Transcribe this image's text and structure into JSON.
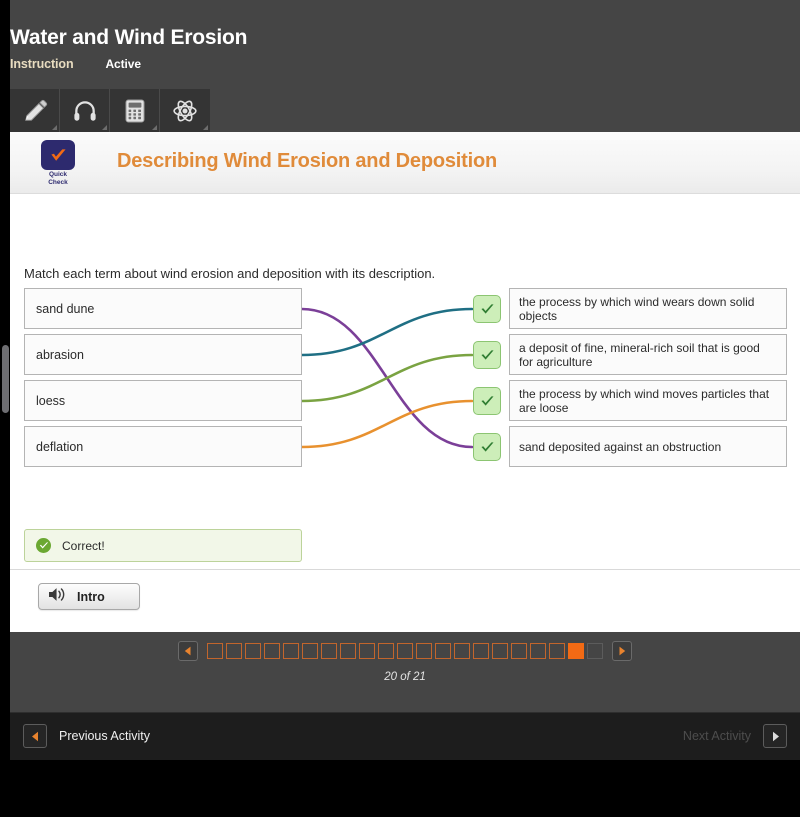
{
  "header": {
    "course_title": "Water and Wind Erosion",
    "section_label": "Instruction",
    "status_label": "Active"
  },
  "toolbar": {
    "items": [
      {
        "name": "pencil-icon",
        "label": "Pencil"
      },
      {
        "name": "headphones-icon",
        "label": "Headphones"
      },
      {
        "name": "calculator-icon",
        "label": "Calculator"
      },
      {
        "name": "atom-icon",
        "label": "Atom"
      }
    ]
  },
  "activity": {
    "badge_line1": "Quick",
    "badge_line2": "Check",
    "title": "Describing Wind Erosion and Deposition",
    "instruction": "Match each term about wind erosion and deposition with its description."
  },
  "match": {
    "terms": [
      {
        "label": "sand dune",
        "color": "#7b3f98"
      },
      {
        "label": "abrasion",
        "color": "#1f6f84"
      },
      {
        "label": "loess",
        "color": "#7aa342"
      },
      {
        "label": "deflation",
        "color": "#e8912f"
      }
    ],
    "descriptions": [
      {
        "label": "the process by which wind wears down solid objects"
      },
      {
        "label": "a deposit of fine, mineral-rich soil that is good for agriculture"
      },
      {
        "label": "the process by which wind moves particles that are loose"
      },
      {
        "label": "sand deposited against an obstruction"
      }
    ],
    "connections": [
      {
        "from": 0,
        "to": 3,
        "color": "#7b3f98"
      },
      {
        "from": 1,
        "to": 0,
        "color": "#1f6f84"
      },
      {
        "from": 2,
        "to": 1,
        "color": "#7aa342"
      },
      {
        "from": 3,
        "to": 2,
        "color": "#e8912f"
      }
    ],
    "check_marks": [
      "✔",
      "✔",
      "✔",
      "✔"
    ]
  },
  "feedback": {
    "text": "Correct!"
  },
  "audio": {
    "intro_label": "Intro"
  },
  "pagination": {
    "prev_arrow": "◀",
    "next_arrow": "▶",
    "total": 21,
    "current": 20,
    "count_text": "20 of 21"
  },
  "bottom_nav": {
    "prev_label": "Previous Activity",
    "next_label": "Next Activity",
    "prev_arrow": "◀",
    "next_arrow": "▶"
  },
  "colors": {
    "accent_orange": "#e08b3a",
    "pager_orange": "#f26a14",
    "badge_navy": "#2d2a6e",
    "check_green": "#2f7d32"
  }
}
